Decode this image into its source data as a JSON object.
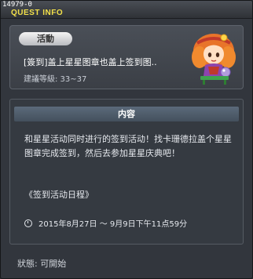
{
  "window": {
    "quest_id": "14979-0",
    "title": "QUEST INFO"
  },
  "header": {
    "badge": "活動",
    "quest_name": "[簽到]盖上星星图章也盖上签到图..",
    "level": "建議等級: 33~37"
  },
  "content": {
    "header": "内容",
    "description": "和星星活动同时进行的签到活动！找卡珊德拉盖个星星图章完成签到，然后去参加星星庆典吧！",
    "schedule": "《签到活动日程》",
    "date_range": "2015年8月27日 ～ 9月9日下午11点59分"
  },
  "status": "狀態: 可開始",
  "icons": {
    "date": "clock-icon",
    "npc": "npc-portrait"
  },
  "colors": {
    "title_accent": "#f2e04a",
    "content_header": "#506070"
  }
}
